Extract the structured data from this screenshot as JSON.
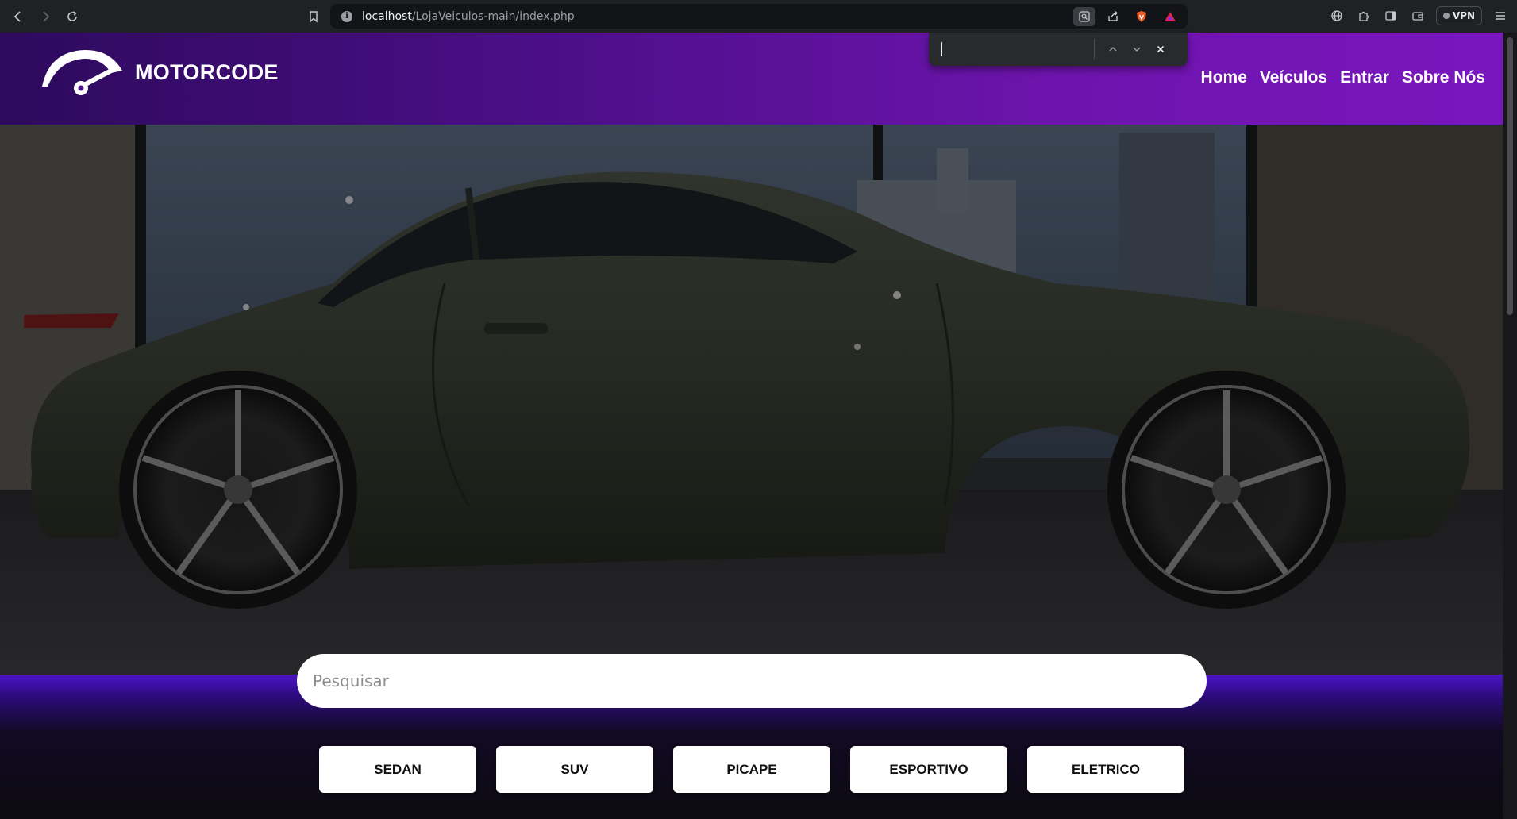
{
  "browser": {
    "url_host": "localhost",
    "url_path": "/LojaVeiculos-main/index.php",
    "vpn_label": "VPN"
  },
  "site": {
    "brand": "MOTORCODE",
    "nav": [
      "Home",
      "Veículos",
      "Entrar",
      "Sobre Nós"
    ]
  },
  "search": {
    "placeholder": "Pesquisar",
    "value": ""
  },
  "find_bar": {
    "query": ""
  },
  "categories": [
    "SEDAN",
    "SUV",
    "PICAPE",
    "ESPORTIVO",
    "ELETRICO"
  ],
  "colors": {
    "header_start": "#2d0a5c",
    "header_end": "#7a16bd",
    "band_accent": "#4a14c6",
    "car_body": "#3d4236"
  }
}
